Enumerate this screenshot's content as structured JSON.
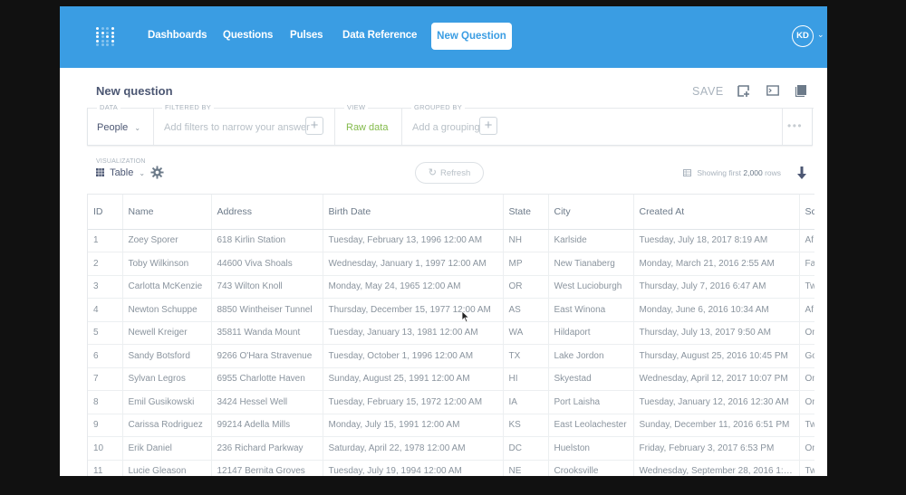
{
  "navbar": {
    "logo": "metabase-logo",
    "links": [
      "Dashboards",
      "Questions",
      "Pulses",
      "Data Reference"
    ],
    "new_question_label": "New Question",
    "avatar_initials": "KD"
  },
  "header": {
    "title": "New question",
    "save_label": "SAVE",
    "icons": [
      "add-to-dashboard-icon",
      "sql-editor-icon",
      "data-reference-icon"
    ]
  },
  "query_builder": {
    "data": {
      "label": "DATA",
      "value": "People"
    },
    "filtered_by": {
      "label": "FILTERED BY",
      "placeholder": "Add filters to narrow your answer"
    },
    "view": {
      "label": "VIEW",
      "value": "Raw data"
    },
    "grouped_by": {
      "label": "GROUPED BY",
      "placeholder": "Add a grouping"
    }
  },
  "visualization": {
    "label": "VISUALIZATION",
    "value": "Table",
    "refresh_label": "Refresh",
    "showing_prefix": "Showing first",
    "row_count": "2,000",
    "showing_suffix": "rows"
  },
  "colors": {
    "brand": "#3a9de3",
    "accent_green": "#84bb4c",
    "text_dark": "#4c5773",
    "text_light": "#a9b3bd"
  },
  "table": {
    "columns": [
      "ID",
      "Name",
      "Address",
      "Birth Date",
      "State",
      "City",
      "Created At",
      "Sc"
    ],
    "rows": [
      [
        "1",
        "Zoey Sporer",
        "618 Kirlin Station",
        "Tuesday, February 13, 1996 12:00 AM",
        "NH",
        "Karlside",
        "Tuesday, July 18, 2017 8:19 AM",
        "Af"
      ],
      [
        "2",
        "Toby Wilkinson",
        "44600 Viva Shoals",
        "Wednesday, January 1, 1997 12:00 AM",
        "MP",
        "New Tianaberg",
        "Monday, March 21, 2016 2:55 AM",
        "Fa"
      ],
      [
        "3",
        "Carlotta McKenzie",
        "743 Wilton Knoll",
        "Monday, May 24, 1965 12:00 AM",
        "OR",
        "West Lucioburgh",
        "Thursday, July 7, 2016 6:47 AM",
        "Tw"
      ],
      [
        "4",
        "Newton Schuppe",
        "8850 Wintheiser Tunnel",
        "Thursday, December 15, 1977 12:00 AM",
        "AS",
        "East Winona",
        "Monday, June 6, 2016 10:34 AM",
        "Af"
      ],
      [
        "5",
        "Newell Kreiger",
        "35811 Wanda Mount",
        "Tuesday, January 13, 1981 12:00 AM",
        "WA",
        "Hildaport",
        "Thursday, July 13, 2017 9:50 AM",
        "On"
      ],
      [
        "6",
        "Sandy Botsford",
        "9266 O'Hara Stravenue",
        "Tuesday, October 1, 1996 12:00 AM",
        "TX",
        "Lake Jordon",
        "Thursday, August 25, 2016 10:45 PM",
        "Go"
      ],
      [
        "7",
        "Sylvan Legros",
        "6955 Charlotte Haven",
        "Sunday, August 25, 1991 12:00 AM",
        "HI",
        "Skyestad",
        "Wednesday, April 12, 2017 10:07 PM",
        "On"
      ],
      [
        "8",
        "Emil Gusikowski",
        "3424 Hessel Well",
        "Tuesday, February 15, 1972 12:00 AM",
        "IA",
        "Port Laisha",
        "Tuesday, January 12, 2016 12:30 AM",
        "On"
      ],
      [
        "9",
        "Carissa Rodriguez",
        "99214 Adella Mills",
        "Monday, July 15, 1991 12:00 AM",
        "KS",
        "East Leolachester",
        "Sunday, December 11, 2016 6:51 PM",
        "Tw"
      ],
      [
        "10",
        "Erik Daniel",
        "236 Richard Parkway",
        "Saturday, April 22, 1978 12:00 AM",
        "DC",
        "Huelston",
        "Friday, February 3, 2017 6:53 PM",
        "On"
      ],
      [
        "11",
        "Lucie Gleason",
        "12147 Bernita Groves",
        "Tuesday, July 19, 1994 12:00 AM",
        "NE",
        "Crooksville",
        "Wednesday, September 28, 2016 1:3...",
        "Tw"
      ]
    ]
  }
}
